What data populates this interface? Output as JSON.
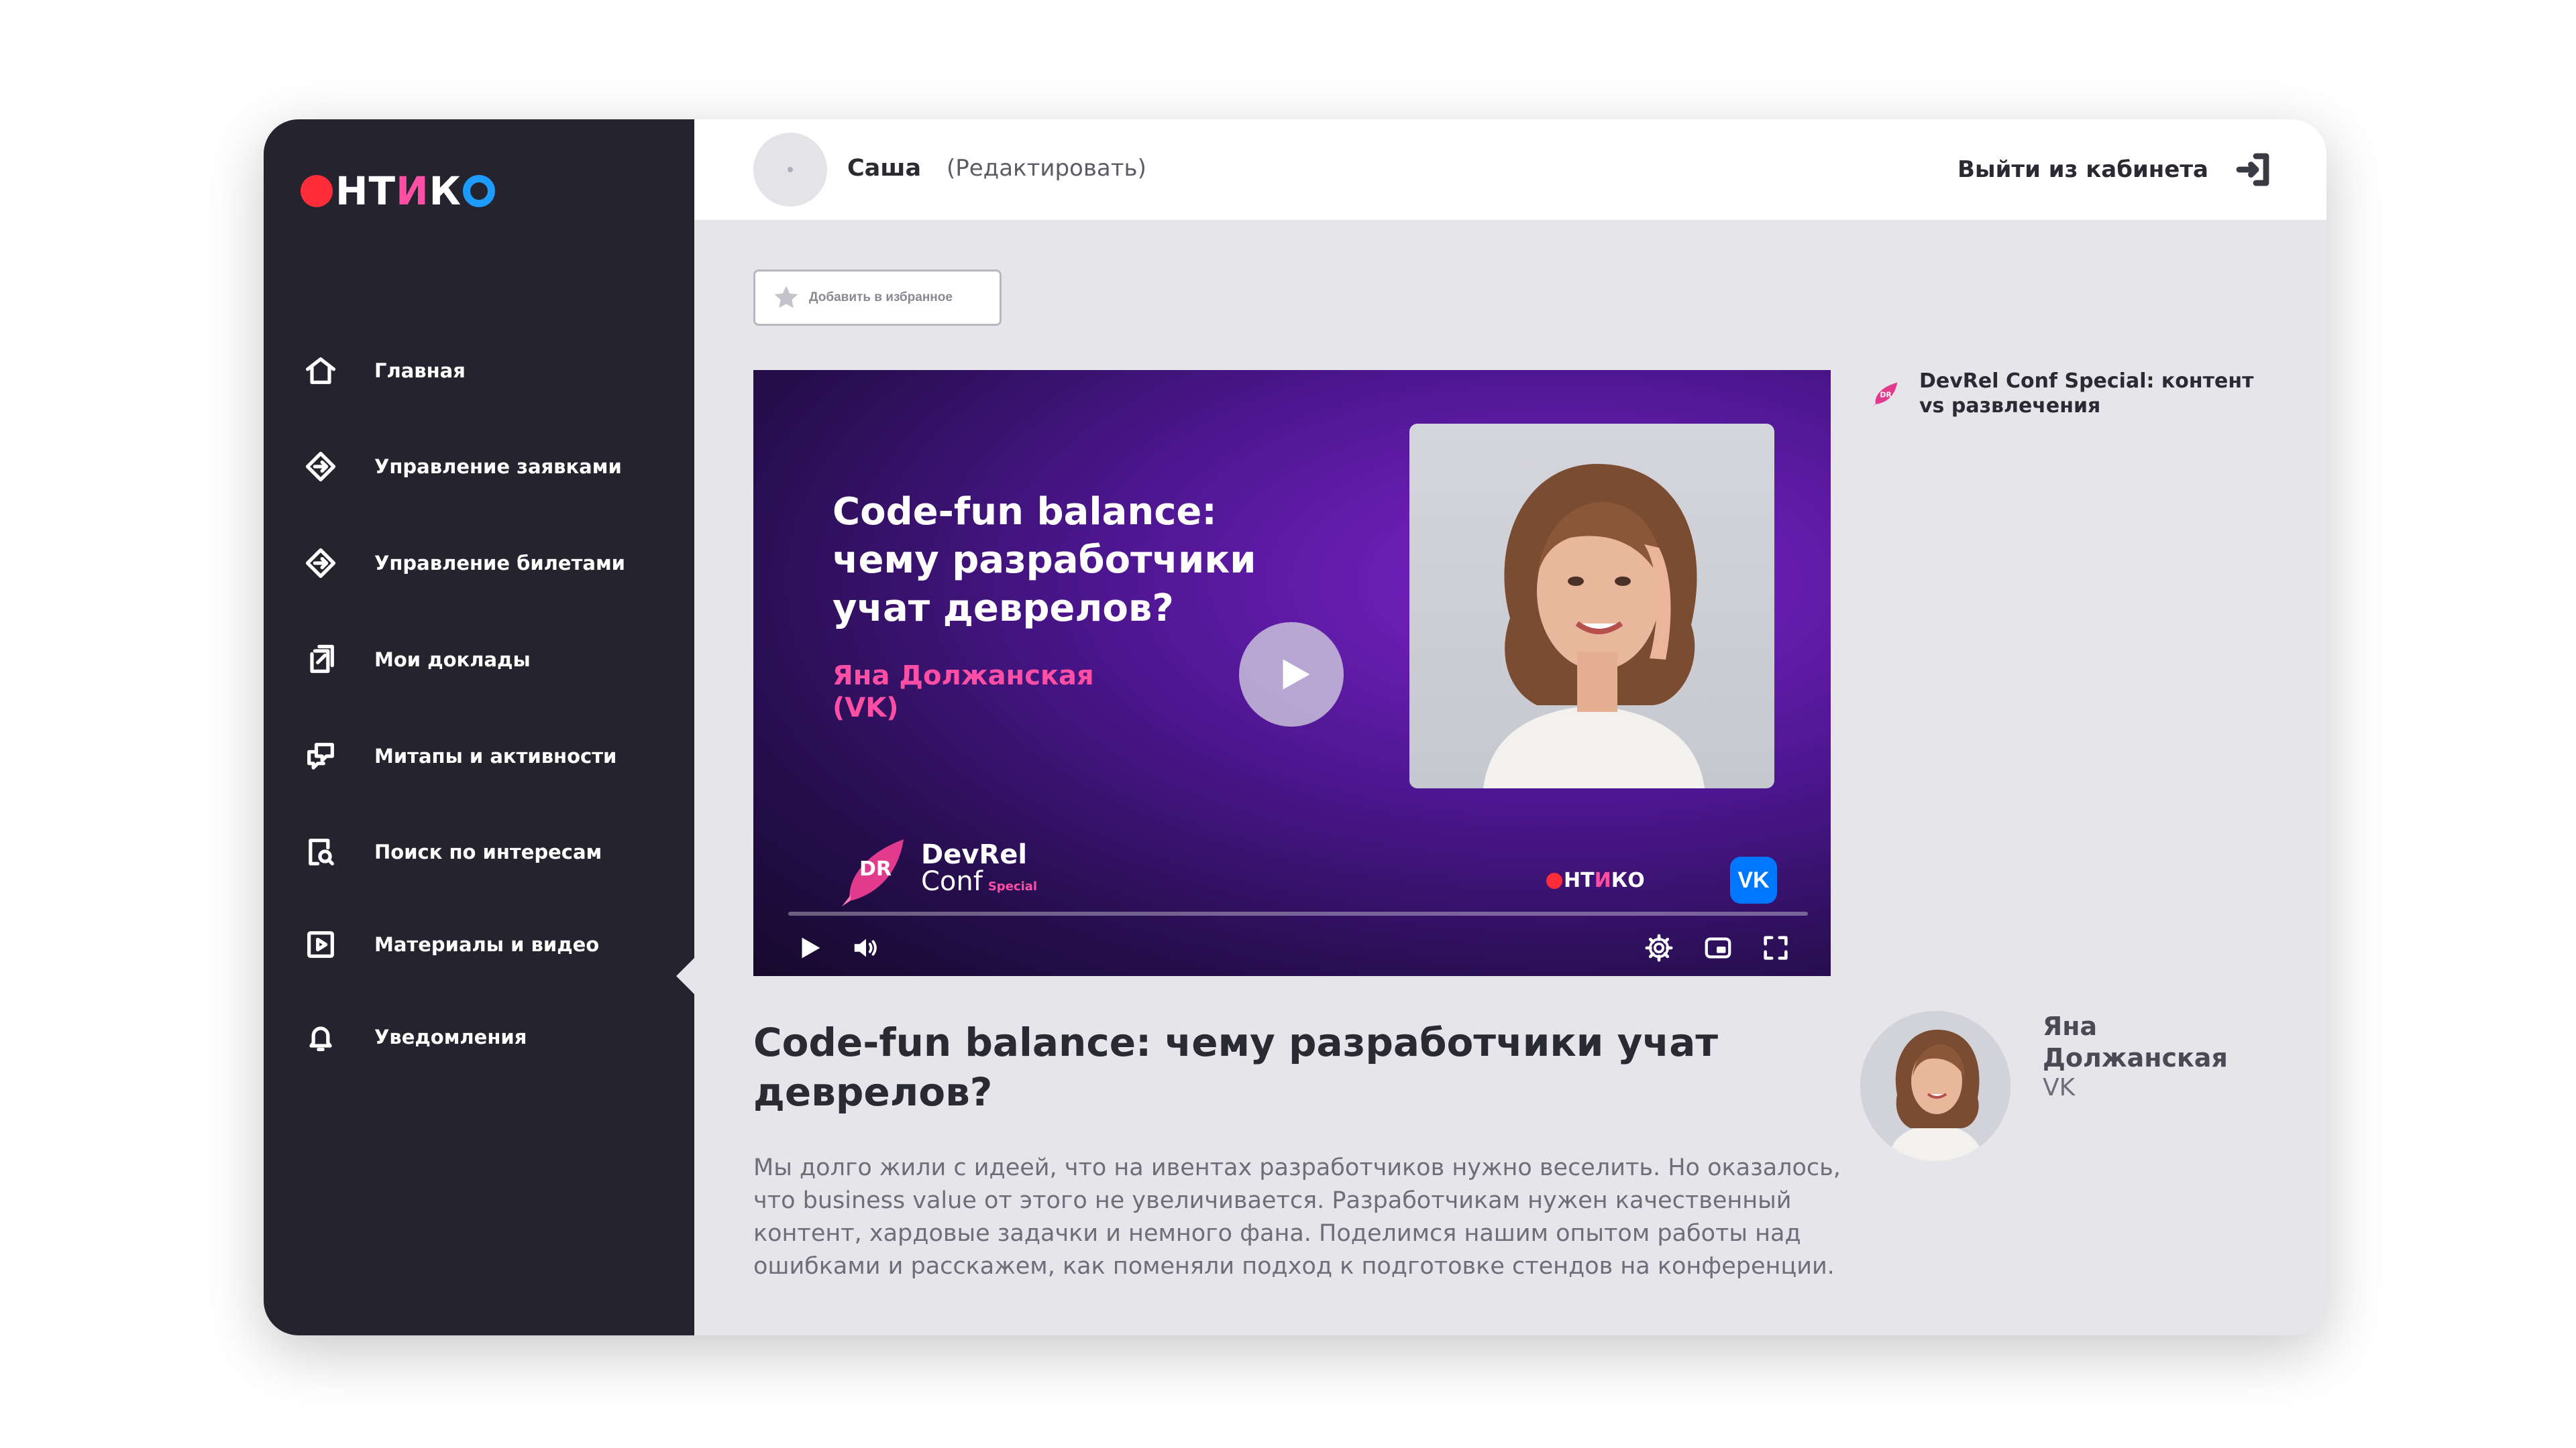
{
  "brand": {
    "logo_text_pre": "Н",
    "logo_text_t": "Т",
    "logo_text_accent": "И",
    "logo_text_k": "К",
    "logo_alt": "ОНТИКО"
  },
  "sidebar": {
    "items": [
      {
        "label": "Главная",
        "icon": "home-icon"
      },
      {
        "label": "Управление заявками",
        "icon": "diamond-arrows-icon"
      },
      {
        "label": "Управление билетами",
        "icon": "diamond-arrows-icon"
      },
      {
        "label": "Мои доклады",
        "icon": "document-edit-icon"
      },
      {
        "label": "Митапы и активности",
        "icon": "chat-bubbles-icon"
      },
      {
        "label": "Поиск по интересам",
        "icon": "document-search-icon"
      },
      {
        "label": "Материалы и видео",
        "icon": "play-square-icon"
      },
      {
        "label": "Уведомления",
        "icon": "bell-icon"
      }
    ],
    "active_index": 6
  },
  "topbar": {
    "user_name": "Саша",
    "edit_label": "(Редактировать)",
    "logout_label": "Выйти из кабинета"
  },
  "favorite_button": {
    "label": "Добавить в избранное"
  },
  "video": {
    "title": "Code-fun balance:\nчему разработчики\nучат деврелов?",
    "speaker": "Яна Должанская\n(VK)",
    "brand_dr": "DR",
    "brand_line1": "DevRel",
    "brand_line2": "Conf",
    "brand_special": "Special",
    "ontico_text_pre": "Н",
    "ontico_text_t": "Т",
    "ontico_text_accent": "И",
    "ontico_text_k": "КО",
    "vk_label": "VK",
    "colors": {
      "background": "#4d1690",
      "accent": "#ff4fa5",
      "vk": "#0077ff"
    }
  },
  "side_talk": {
    "label": "DevRel Conf Special: контент vs развлечения",
    "icon": "rocket-icon"
  },
  "talk": {
    "title": "Code-fun balance: чему разработчики учат деврелов?",
    "description": "Мы долго жили с идеей, что на ивентах разработчиков нужно веселить. Но оказалось, что business value от этого не увеличивается. Разработчикам нужен качественный контент, хардовые задачки и немного фана. Поделимся нашим опытом работы над ошибками и расскажем, как поменяли подход к подготовке стендов на конференции."
  },
  "speaker": {
    "name": "Яна Должанская",
    "company": "VK"
  },
  "colors": {
    "sidebar": "#25232e",
    "content_bg": "#e6e5ea",
    "brand_red": "#ff2d3a",
    "brand_pink": "#ff4fa5",
    "brand_blue": "#1e9bff"
  }
}
